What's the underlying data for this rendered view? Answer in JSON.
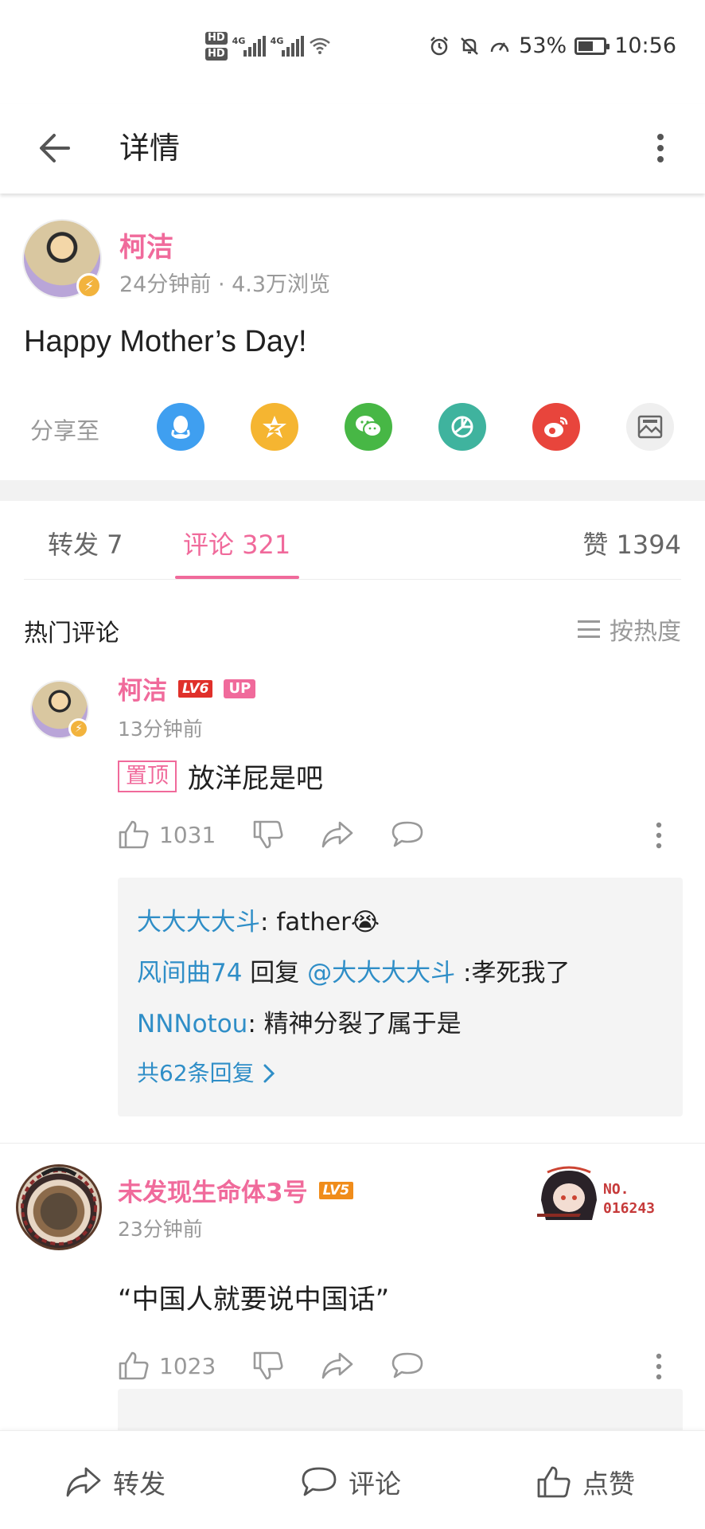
{
  "status_bar": {
    "hd1": "HD",
    "hd2": "HD",
    "net1": "4G",
    "net2": "4G",
    "battery_percent": "53%",
    "time": "10:56",
    "icons": [
      "alarm-icon",
      "mute-icon",
      "speed-icon",
      "wifi-icon",
      "battery-icon"
    ]
  },
  "app_bar": {
    "title": "详情"
  },
  "post": {
    "author": "柯洁",
    "meta": "24分钟前 · 4.3万浏览",
    "text": "Happy Mother’s Day!",
    "share_label": "分享至",
    "share_targets": [
      {
        "name": "qq",
        "icon": "qq-icon",
        "color": "#3f9ff0"
      },
      {
        "name": "qzone",
        "icon": "qzone-icon",
        "color": "#f5b531"
      },
      {
        "name": "wechat",
        "icon": "wechat-icon",
        "color": "#47b745"
      },
      {
        "name": "moments",
        "icon": "moments-icon",
        "color": "#3fb39e"
      },
      {
        "name": "weibo",
        "icon": "weibo-icon",
        "color": "#e8453c"
      },
      {
        "name": "image",
        "icon": "image-icon",
        "color": "#efefef"
      }
    ]
  },
  "tabs": {
    "repost": "转发 7",
    "comments": "评论 321",
    "likes": "赞 1394"
  },
  "comments_header": {
    "title": "热门评论",
    "sort_label": "按热度"
  },
  "comments": [
    {
      "user": "柯洁",
      "level": "LV6",
      "up_badge": "UP",
      "time": "13分钟前",
      "pin_tag": "置顶",
      "text": "放洋屁是吧",
      "like_count": "1031",
      "replies": [
        {
          "user": "大大大大斗",
          "sep": ": ",
          "text": "father",
          "emoji": "😭"
        },
        {
          "user": "风间曲74",
          "action": " 回复 ",
          "mention": "@大大大大斗",
          "text": " :孝死我了"
        },
        {
          "user": "NNNotou",
          "sep": ": ",
          "text": "精神分裂了属于是"
        }
      ],
      "more_replies": "共62条回复"
    },
    {
      "user": "未发现生命体3号",
      "level": "LV5",
      "time": "23分钟前",
      "text": "“中国人就要说中国话”",
      "like_count": "1023",
      "pendant_number": "NO.\n016243"
    }
  ],
  "bottom_bar": {
    "repost": "转发",
    "comment": "评论",
    "like": "点赞"
  },
  "colors": {
    "accent_pink": "#f06a9b",
    "link_blue": "#2f8ec7",
    "lv6_red": "#e0302a",
    "lv5_orange": "#f08c1a"
  }
}
